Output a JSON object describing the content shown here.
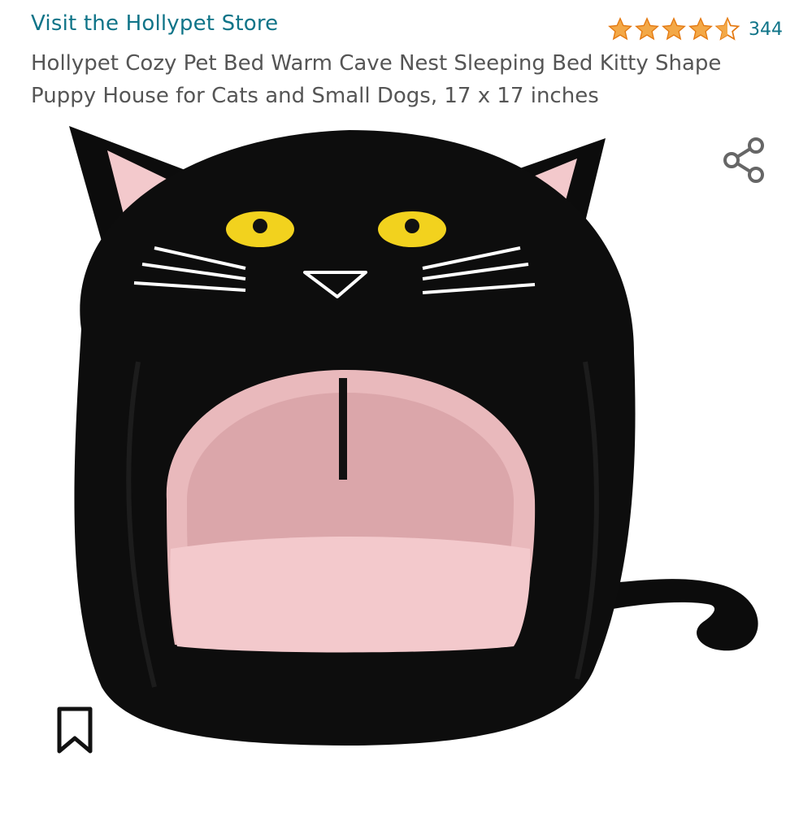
{
  "store": {
    "link_label": "Visit the Hollypet Store"
  },
  "rating": {
    "stars_value": 4.5,
    "count": "344",
    "star_color": "#f3a847",
    "star_outline": "#e47911"
  },
  "product": {
    "title": "Hollypet Cozy Pet Bed Warm Cave Nest Sleeping Bed Kitty Shape Puppy House for Cats and Small Dogs, 17 x 17 inches",
    "image_alt": "Black cat-shaped pet cave bed with pink interior, pink ears, yellow eyes, white whiskers and a curled tail"
  },
  "actions": {
    "share_icon": "share-icon",
    "save_icon": "bookmark-icon"
  },
  "colors": {
    "link": "#0f7488",
    "title_text": "#555555"
  }
}
